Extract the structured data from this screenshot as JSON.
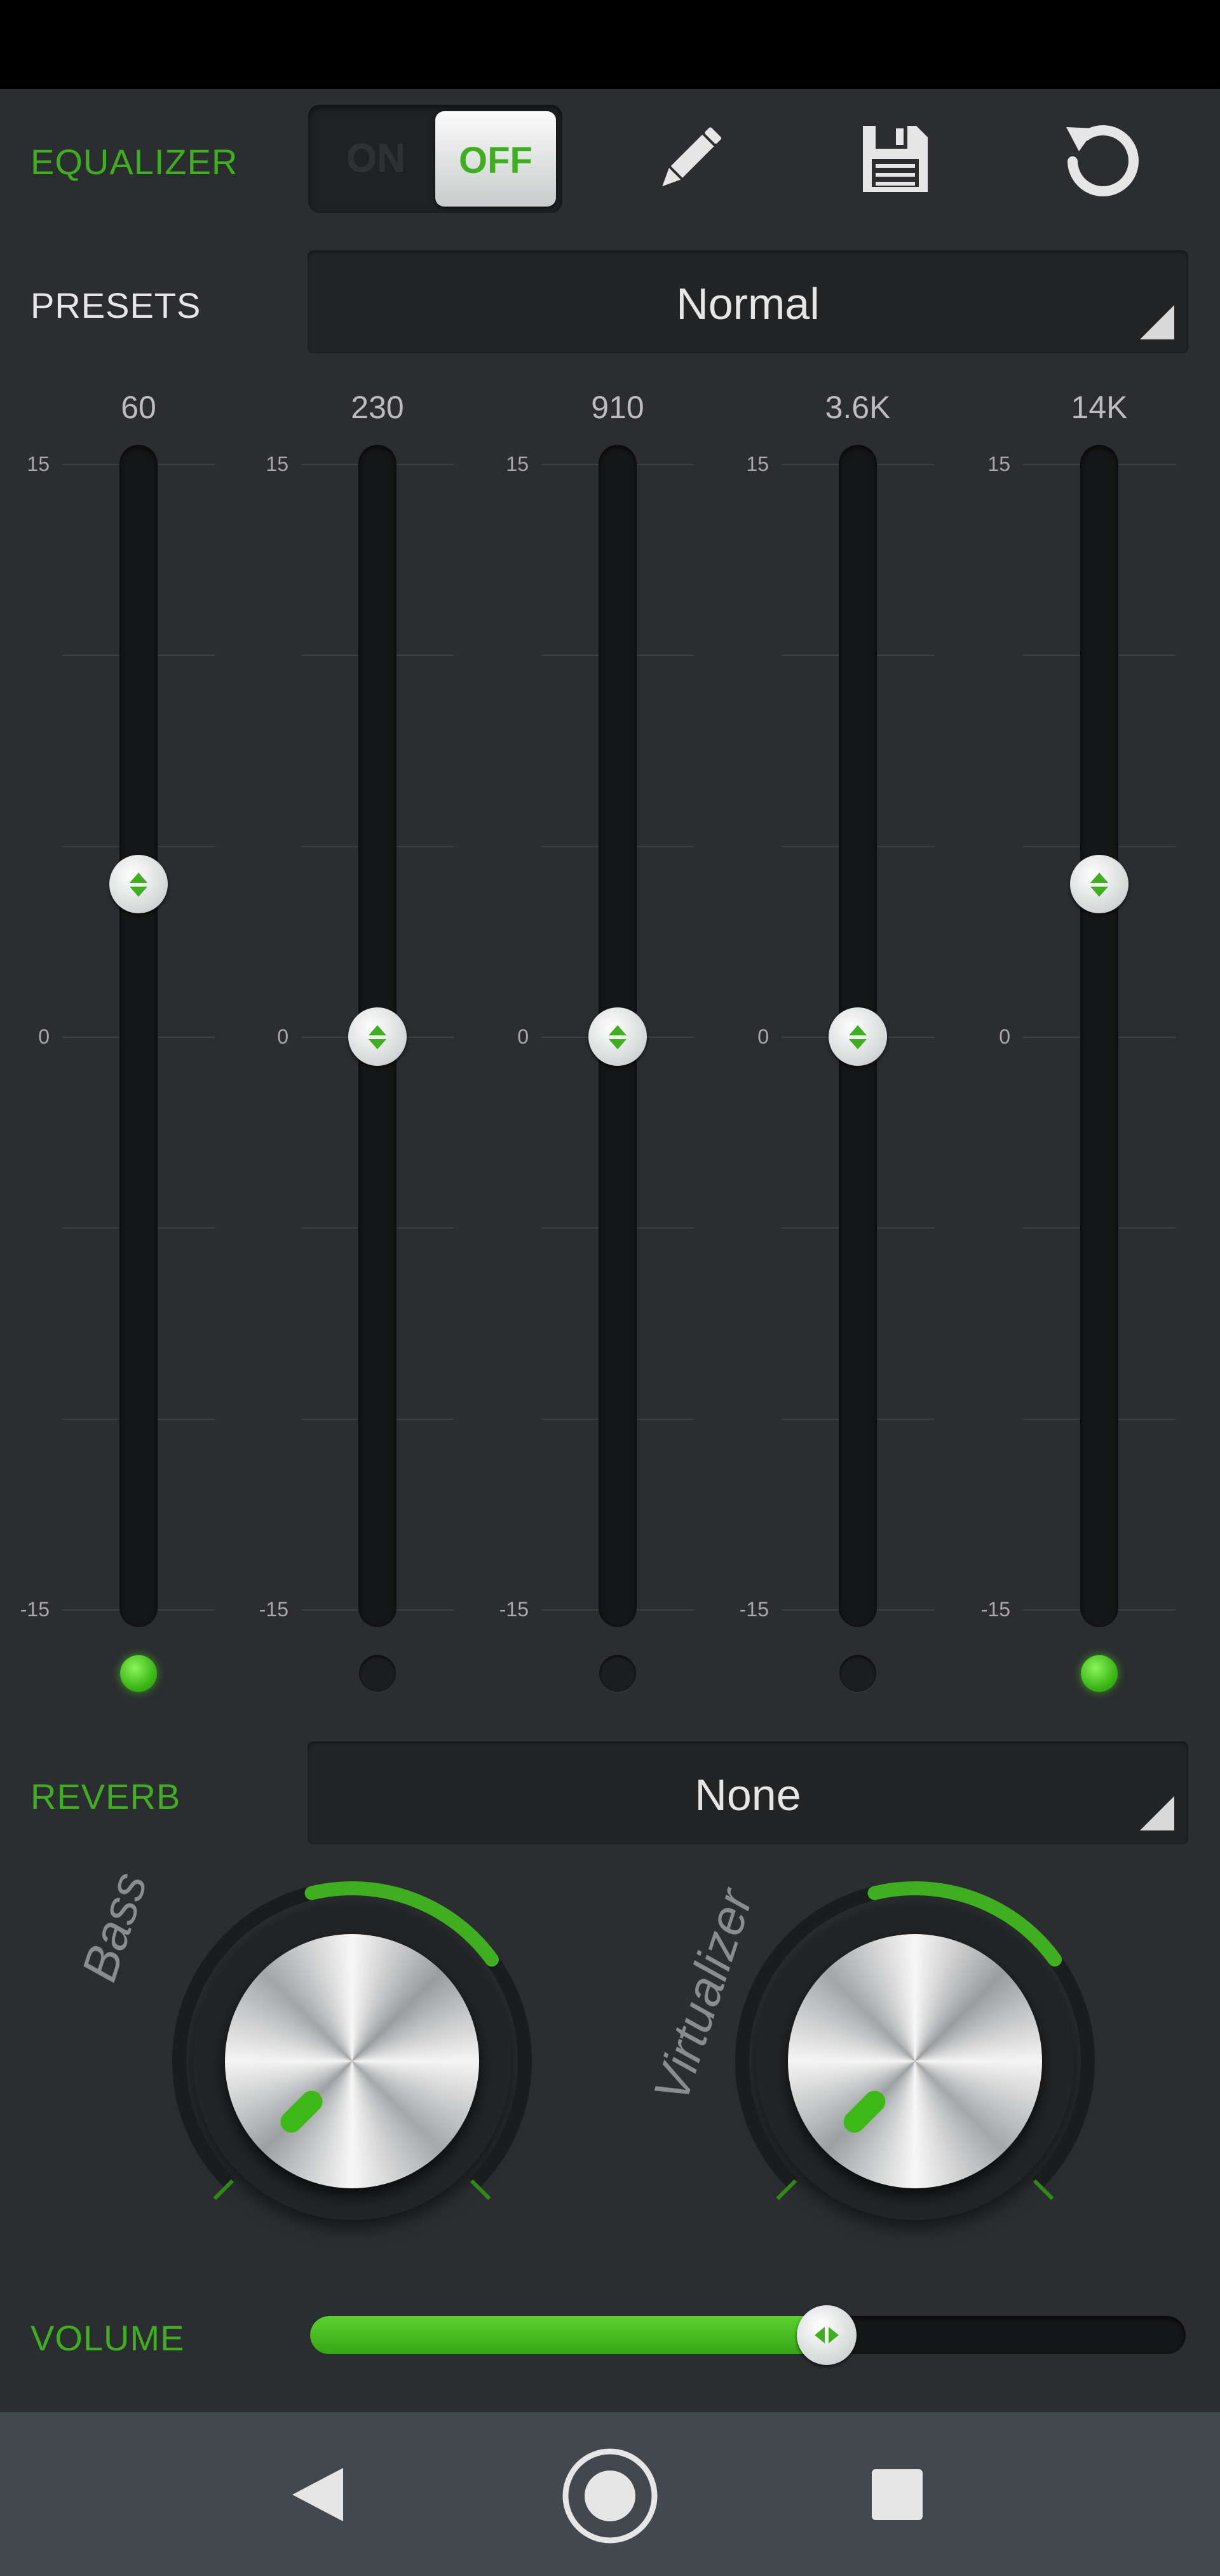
{
  "header": {
    "equalizer_label": "EQUALIZER",
    "toggle_on_text": "ON",
    "toggle_off_text": "OFF",
    "icons": [
      "pencil-icon",
      "floppy-disk-icon",
      "reset-icon"
    ]
  },
  "presets": {
    "label": "PRESETS",
    "selected": "Normal"
  },
  "equalizer": {
    "scale_max": "15",
    "scale_mid": "0",
    "scale_min": "-15",
    "bands": [
      {
        "label": "60",
        "value": 4,
        "led_on": true
      },
      {
        "label": "230",
        "value": 0,
        "led_on": false
      },
      {
        "label": "910",
        "value": 0,
        "led_on": false
      },
      {
        "label": "3.6K",
        "value": 0,
        "led_on": false
      },
      {
        "label": "14K",
        "value": 4,
        "led_on": true
      }
    ]
  },
  "reverb": {
    "label": "REVERB",
    "selected": "None"
  },
  "knobs": {
    "bass": {
      "label": "Bass",
      "level": 0.7
    },
    "virtualizer": {
      "label": "Virtualizer",
      "level": 0.7
    }
  },
  "volume": {
    "label": "VOLUME",
    "level": 0.59
  },
  "colors": {
    "accent": "#3fae1f",
    "background": "#2b2d30",
    "navbar": "#41484e"
  },
  "navbar": {
    "icons": [
      "back-icon",
      "home-icon",
      "recents-icon"
    ]
  }
}
